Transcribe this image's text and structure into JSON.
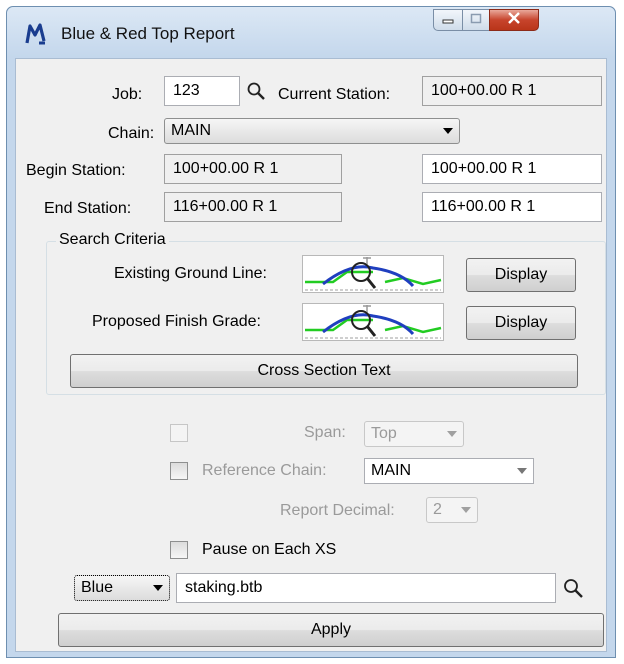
{
  "window": {
    "title": "Blue & Red Top Report",
    "app_icon": "microstation-m-icon",
    "controls": [
      "minimize-icon",
      "maximize-icon",
      "close-icon"
    ]
  },
  "form": {
    "job_label": "Job:",
    "job_value": "123",
    "current_station_label": "Current Station:",
    "current_station_value": "100+00.00 R 1",
    "chain_label": "Chain:",
    "chain_value": "MAIN",
    "begin_station_label": "Begin Station:",
    "begin_station_readonly": "100+00.00 R 1",
    "begin_station_value": "100+00.00 R 1",
    "end_station_label": "End Station:",
    "end_station_readonly": "116+00.00 R 1",
    "end_station_value": "116+00.00 R 1"
  },
  "search_criteria": {
    "title": "Search Criteria",
    "existing_ground_label": "Existing Ground Line:",
    "proposed_finish_label": "Proposed Finish Grade:",
    "display_label": "Display",
    "cross_section_text_label": "Cross Section Text"
  },
  "options": {
    "span_label": "Span:",
    "span_value": "Top",
    "reference_chain_label": "Reference Chain:",
    "reference_chain_value": "MAIN",
    "report_decimal_label": "Report Decimal:",
    "report_decimal_value": "2",
    "pause_label": "Pause on Each XS"
  },
  "output": {
    "color_value": "Blue",
    "file_value": "staking.btb",
    "apply_label": "Apply"
  },
  "colors": {
    "accent": "#1a3d8f",
    "close_red": "#c7442c",
    "ground_green": "#22cc22",
    "line_blue": "#1f3fbf"
  }
}
